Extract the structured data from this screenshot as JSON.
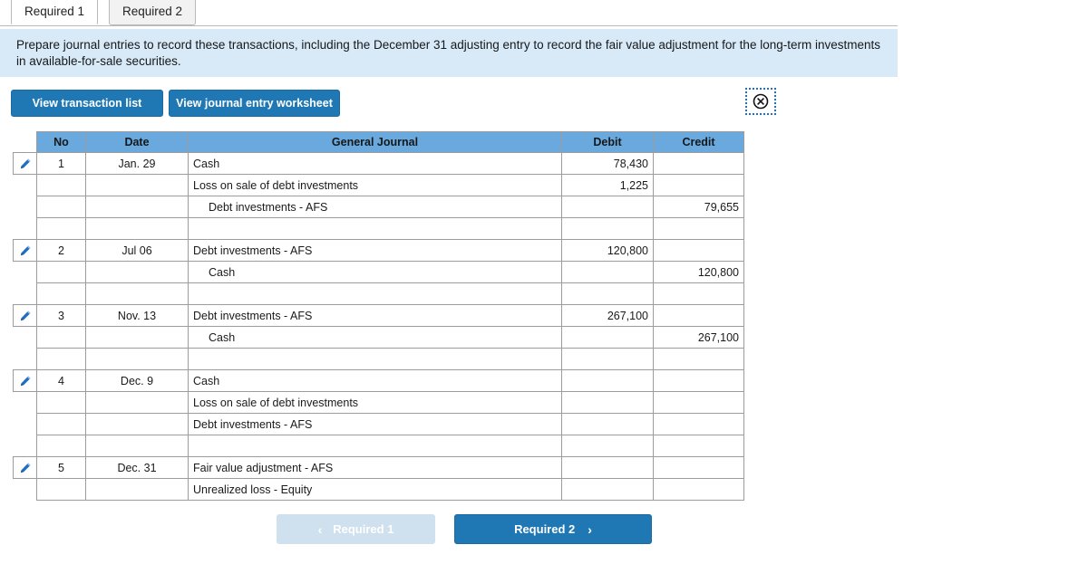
{
  "tabs": [
    {
      "label": "Required 1",
      "active": true
    },
    {
      "label": "Required 2",
      "active": false
    }
  ],
  "instruction": "Prepare journal entries to record these transactions, including the December 31 adjusting entry to record the fair value adjustment for the long-term investments in available-for-sale securities.",
  "toolbar": {
    "view_transaction_list": "View transaction list",
    "view_journal_worksheet": "View journal entry worksheet",
    "broken_image_icon": "broken-image-icon"
  },
  "table": {
    "headers": {
      "no": "No",
      "date": "Date",
      "general_journal": "General Journal",
      "debit": "Debit",
      "credit": "Credit"
    },
    "edit_icon": "pencil-icon",
    "rows": [
      {
        "edit": true,
        "no": "1",
        "date": "Jan. 29",
        "account": "Cash",
        "indent": false,
        "debit": "78,430",
        "credit": ""
      },
      {
        "edit": false,
        "no": "",
        "date": "",
        "account": "Loss on sale of debt investments",
        "indent": false,
        "debit": "1,225",
        "credit": ""
      },
      {
        "edit": false,
        "no": "",
        "date": "",
        "account": "Debt investments - AFS",
        "indent": true,
        "debit": "",
        "credit": "79,655"
      },
      {
        "edit": false,
        "no": "",
        "date": "",
        "account": "",
        "indent": false,
        "debit": "",
        "credit": ""
      },
      {
        "edit": true,
        "no": "2",
        "date": "Jul 06",
        "account": "Debt investments - AFS",
        "indent": false,
        "debit": "120,800",
        "credit": ""
      },
      {
        "edit": false,
        "no": "",
        "date": "",
        "account": "Cash",
        "indent": true,
        "debit": "",
        "credit": "120,800"
      },
      {
        "edit": false,
        "no": "",
        "date": "",
        "account": "",
        "indent": false,
        "debit": "",
        "credit": ""
      },
      {
        "edit": true,
        "no": "3",
        "date": "Nov. 13",
        "account": "Debt investments - AFS",
        "indent": false,
        "debit": "267,100",
        "credit": ""
      },
      {
        "edit": false,
        "no": "",
        "date": "",
        "account": "Cash",
        "indent": true,
        "debit": "",
        "credit": "267,100"
      },
      {
        "edit": false,
        "no": "",
        "date": "",
        "account": "",
        "indent": false,
        "debit": "",
        "credit": ""
      },
      {
        "edit": true,
        "no": "4",
        "date": "Dec. 9",
        "account": "Cash",
        "indent": false,
        "debit": "",
        "credit": ""
      },
      {
        "edit": false,
        "no": "",
        "date": "",
        "account": "Loss on sale of debt investments",
        "indent": false,
        "debit": "",
        "credit": ""
      },
      {
        "edit": false,
        "no": "",
        "date": "",
        "account": "Debt investments - AFS",
        "indent": false,
        "debit": "",
        "credit": ""
      },
      {
        "edit": false,
        "no": "",
        "date": "",
        "account": "",
        "indent": false,
        "debit": "",
        "credit": ""
      },
      {
        "edit": true,
        "no": "5",
        "date": "Dec. 31",
        "account": "Fair value adjustment - AFS",
        "indent": false,
        "debit": "",
        "credit": ""
      },
      {
        "edit": false,
        "no": "",
        "date": "",
        "account": "Unrealized loss - Equity",
        "indent": false,
        "debit": "",
        "credit": ""
      }
    ]
  },
  "nav": {
    "prev_label": "Required 1",
    "prev_chevron": "‹",
    "next_label": "Required 2",
    "next_chevron": "›"
  },
  "colors": {
    "header_blue": "#69a9dd",
    "banner_blue": "#d8eaf8",
    "button_blue": "#1f78b4",
    "disabled_blue": "#cfe0ee",
    "grid_gray": "#9c9c9c"
  }
}
